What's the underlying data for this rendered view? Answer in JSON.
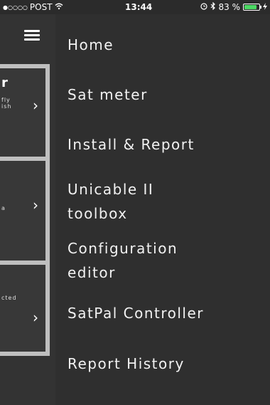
{
  "status_bar": {
    "signal": "●○○○○",
    "carrier": "POST",
    "wifi_icon": "wifi-icon",
    "time": "13:44",
    "battery_text": "83 %",
    "battery_level": 0.83,
    "battery_color": "#4cd964"
  },
  "background_cards": [
    {
      "big_fragment": "r",
      "small_fragment": "fly\nish"
    },
    {
      "small_fragment": "a"
    },
    {
      "small_fragment": "cted"
    }
  ],
  "menu": {
    "items": [
      {
        "label": "Home"
      },
      {
        "label": "Sat meter"
      },
      {
        "label": "Install & Report"
      },
      {
        "label": "Unicable II\ntoolbox"
      },
      {
        "label": "Configuration\neditor"
      },
      {
        "label": "SatPal Controller"
      },
      {
        "label": "Report History"
      }
    ]
  }
}
